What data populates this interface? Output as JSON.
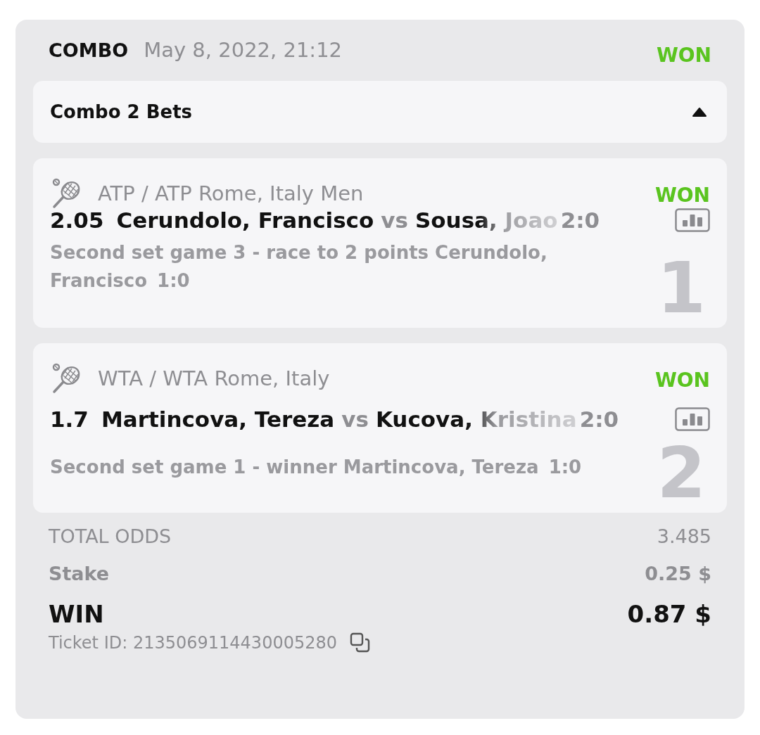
{
  "header": {
    "type": "COMBO",
    "date": "May 8, 2022, 21:12",
    "status": "WON"
  },
  "combo_toggle": {
    "label": "Combo 2 Bets",
    "expanded": true
  },
  "bets": [
    {
      "index": "1",
      "league": "ATP / ATP Rome, Italy Men",
      "status": "WON",
      "odds": "2.05",
      "team1": "Cerundolo, Francisco",
      "vs": "vs",
      "team2": "Sousa, Joao",
      "score": "2:0",
      "market": "Second set game 3 - race to 2 points Cerundolo, Francisco",
      "result": "1:0"
    },
    {
      "index": "2",
      "league": "WTA / WTA Rome, Italy",
      "status": "WON",
      "odds": "1.7",
      "team1": "Martincova, Tereza",
      "vs": "vs",
      "team2": "Kucova, Kristina",
      "score": "2:0",
      "market": "Second set game 1 - winner Martincova, Tereza",
      "result": "1:0"
    }
  ],
  "summary": {
    "total_odds_label": "TOTAL ODDS",
    "total_odds": "3.485",
    "stake_label": "Stake",
    "stake": "0.25 $",
    "win_label": "WIN",
    "win": "0.87 $",
    "ticket": "Ticket ID: 2135069114430005280"
  }
}
